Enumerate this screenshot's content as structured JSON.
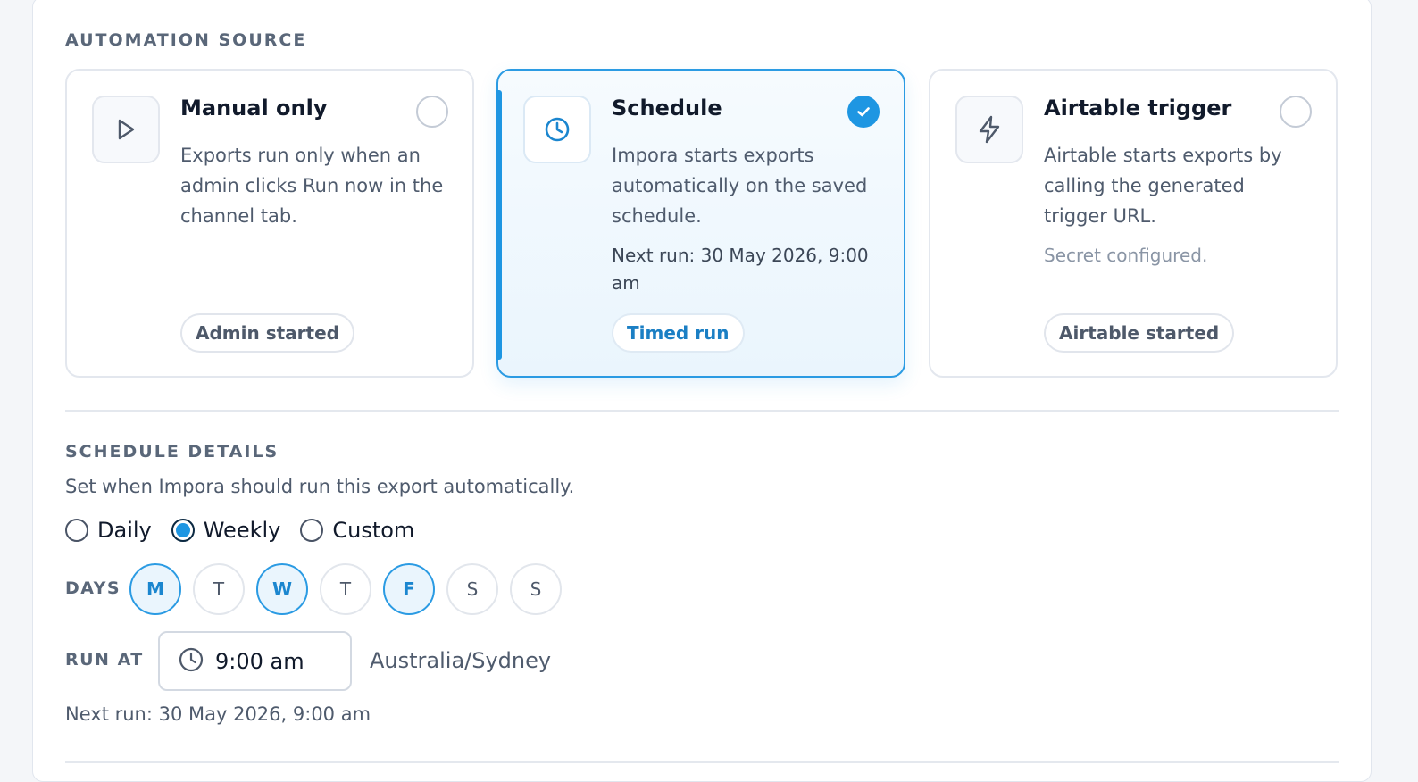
{
  "automation_source": {
    "label": "AUTOMATION SOURCE",
    "cards": [
      {
        "title": "Manual only",
        "description": "Exports run only when an admin clicks Run now in the channel tab.",
        "pill": "Admin started",
        "icon": "play-icon",
        "selected": false
      },
      {
        "title": "Schedule",
        "description": "Impora starts exports automatically on the saved schedule.",
        "extra": "Next run: 30 May 2026, 9:00 am",
        "pill": "Timed run",
        "icon": "clock-icon",
        "selected": true
      },
      {
        "title": "Airtable trigger",
        "description": "Airtable starts exports by calling the generated trigger URL.",
        "extra": "Secret configured.",
        "pill": "Airtable started",
        "icon": "lightning-icon",
        "selected": false
      }
    ]
  },
  "schedule_details": {
    "label": "SCHEDULE DETAILS",
    "subtitle": "Set when Impora should run this export automatically.",
    "frequency": {
      "options": [
        "Daily",
        "Weekly",
        "Custom"
      ],
      "selected": "Weekly"
    },
    "days": {
      "label": "DAYS",
      "items": [
        {
          "letter": "M",
          "selected": true
        },
        {
          "letter": "T",
          "selected": false
        },
        {
          "letter": "W",
          "selected": true
        },
        {
          "letter": "T",
          "selected": false
        },
        {
          "letter": "F",
          "selected": true
        },
        {
          "letter": "S",
          "selected": false
        },
        {
          "letter": "S",
          "selected": false
        }
      ]
    },
    "run_at": {
      "label": "RUN AT",
      "time": "9:00 am",
      "timezone": "Australia/Sydney"
    },
    "next_run": "Next run: 30 May 2026, 9:00 am"
  },
  "colors": {
    "accent": "#1e96e2",
    "accent_text": "#1b7fc4",
    "label": "#5a6779",
    "muted": "#8a95a5"
  }
}
